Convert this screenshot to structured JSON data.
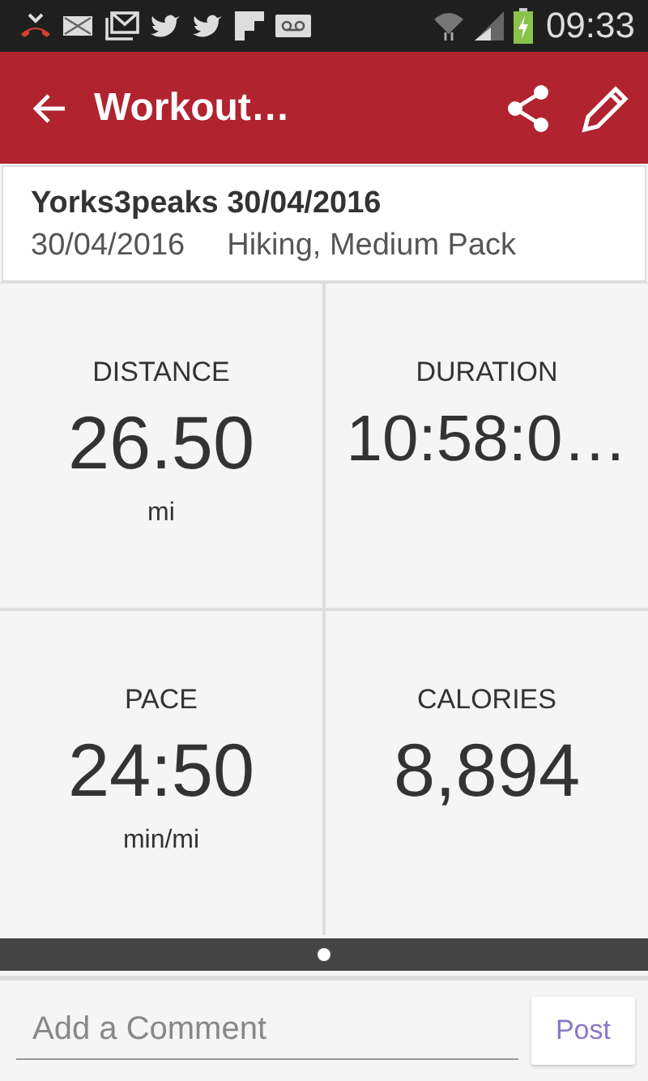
{
  "status_bar": {
    "time": "09:33"
  },
  "app_bar": {
    "title": "Workout…"
  },
  "summary": {
    "name": "Yorks3peaks 30/04/2016",
    "date": "30/04/2016",
    "activity": "Hiking, Medium Pack"
  },
  "stats": [
    {
      "label": "DISTANCE",
      "value": "26.50",
      "unit": "mi"
    },
    {
      "label": "DURATION",
      "value": "10:58:0…"
    },
    {
      "label": "PACE",
      "value": "24:50",
      "unit": "min/mi"
    },
    {
      "label": "CALORIES",
      "value": "8,894"
    }
  ],
  "pager": [
    {
      "selected": true
    }
  ],
  "comment": {
    "placeholder": "Add a Comment",
    "button": "Post"
  }
}
